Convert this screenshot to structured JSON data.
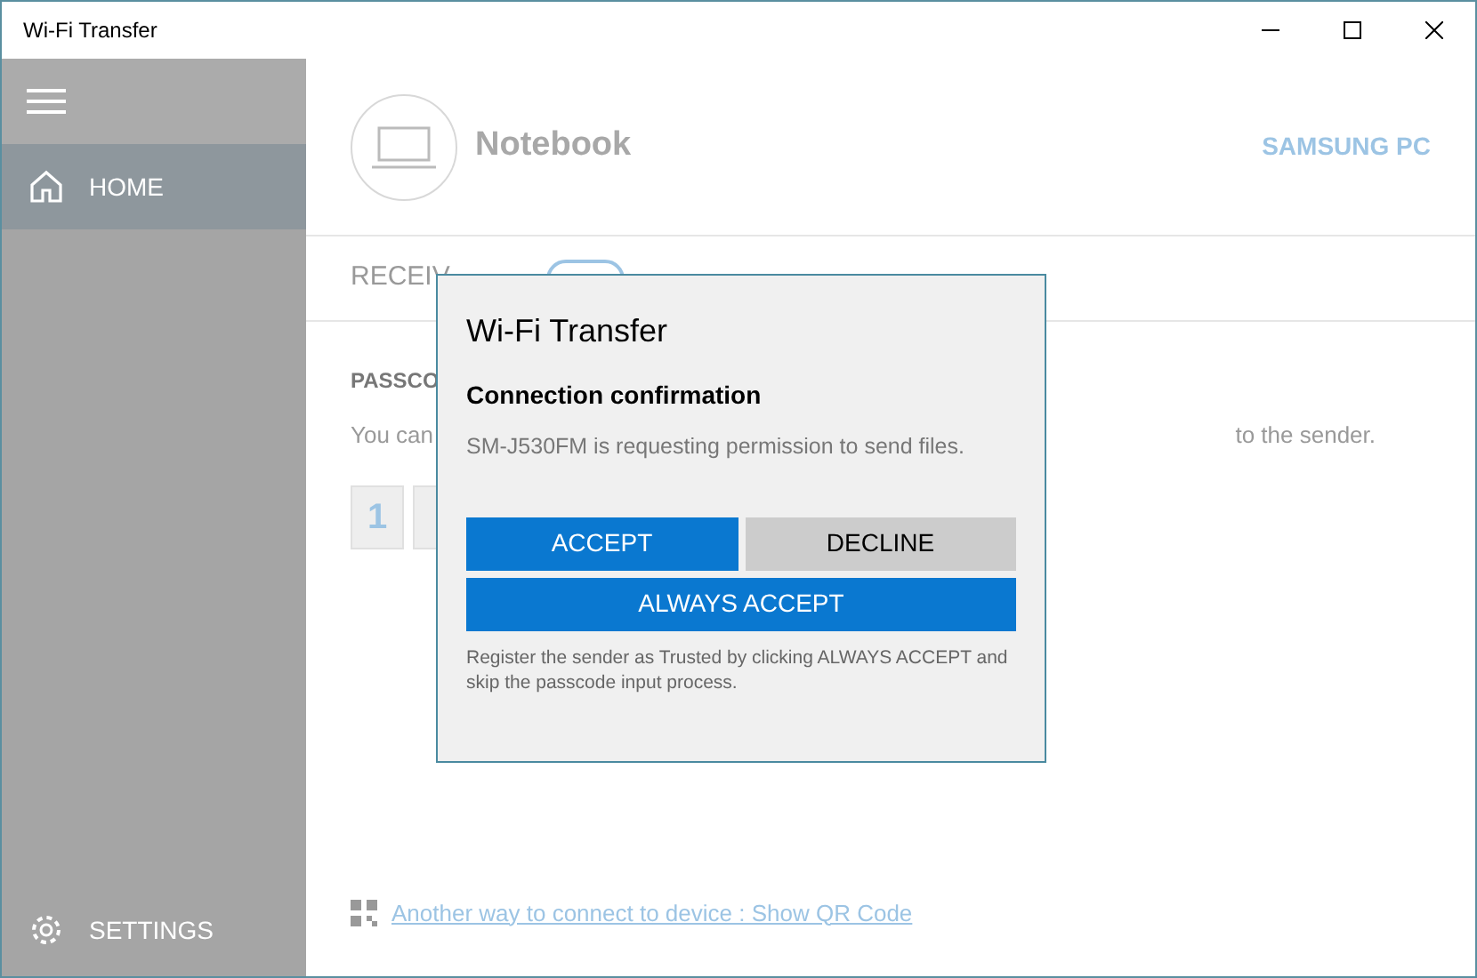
{
  "window": {
    "title": "Wi-Fi Transfer"
  },
  "sidebar": {
    "items": [
      {
        "kind": "home",
        "label": "HOME",
        "selected": true
      }
    ],
    "footer": {
      "label": "SETTINGS"
    }
  },
  "device": {
    "name": "Notebook",
    "pc_name": "SAMSUNG PC"
  },
  "tabs": [
    {
      "label": "RECEIV"
    }
  ],
  "mode_toggle": {
    "on": false
  },
  "passcode": {
    "label": "PASSCO",
    "text_start": "You can",
    "text_end": "to the sender.",
    "digits": [
      {
        "kind": "digit",
        "text": "1"
      },
      {
        "kind": "covered"
      }
    ]
  },
  "link": "Another way to connect to device : Show QR Code",
  "dialog": {
    "title": "Wi-Fi Transfer",
    "heading": "Connection confirmation",
    "message": "SM-J530FM is requesting permission to send files.",
    "buttons": [
      {
        "label": "ACCEPT",
        "kind": "primary"
      },
      {
        "label": "DECLINE",
        "kind": "secondary"
      },
      {
        "label": "ALWAYS ACCEPT",
        "kind": "primary"
      }
    ],
    "note": "Register the sender as Trusted by clicking ALWAYS ACCEPT and skip the passcode input process."
  }
}
